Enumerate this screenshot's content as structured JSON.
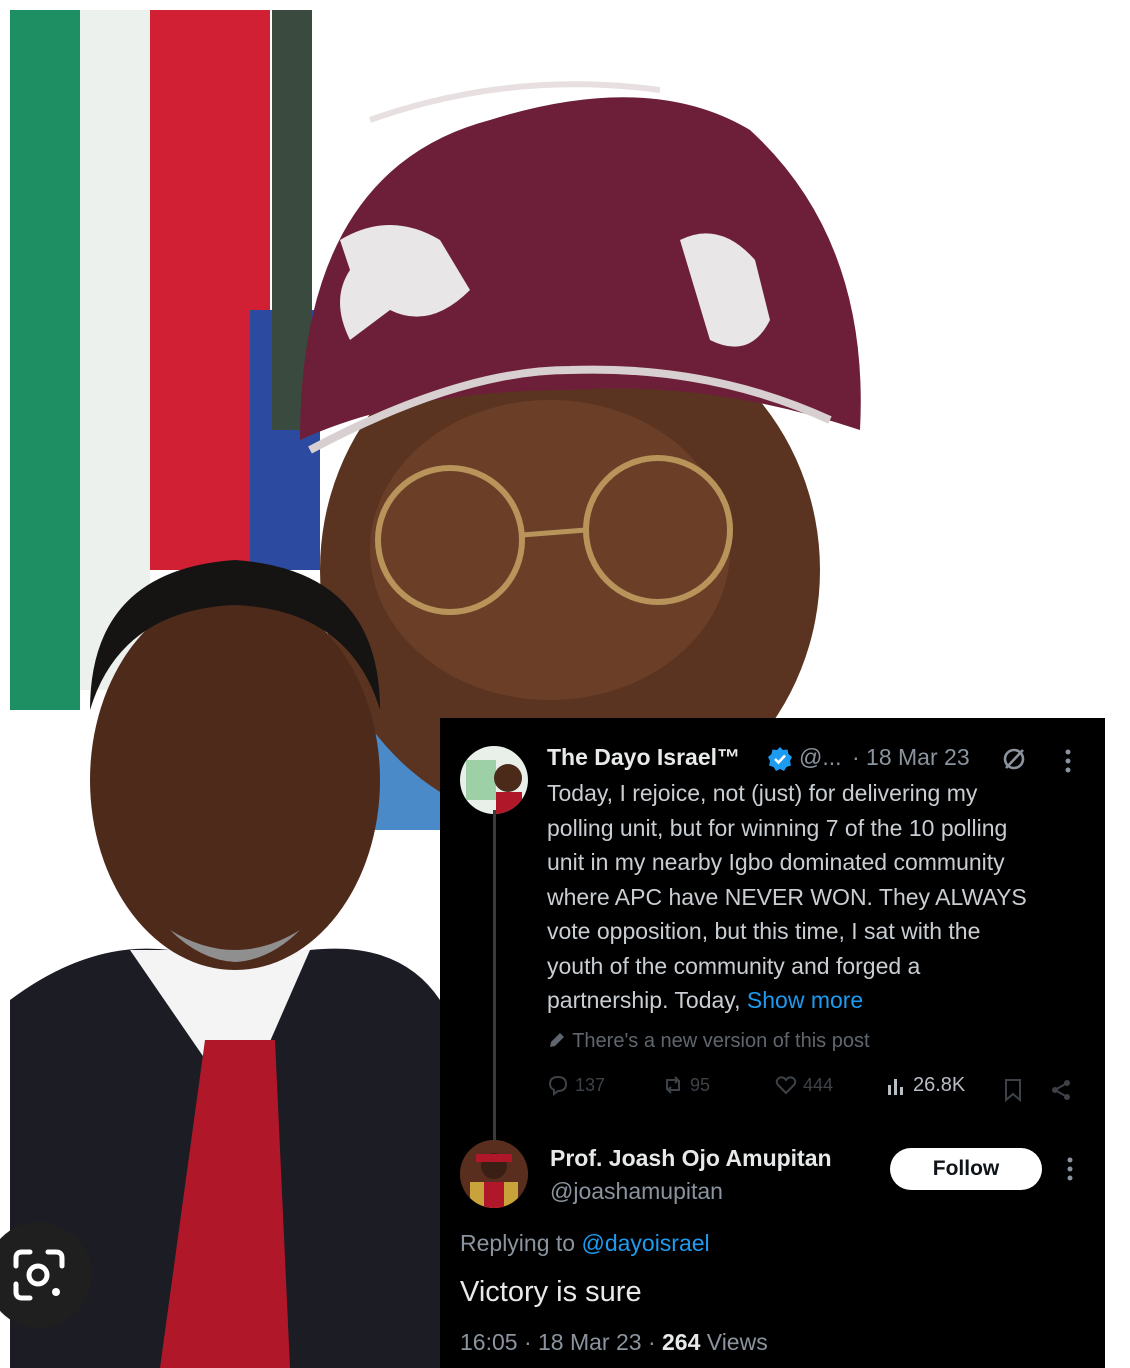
{
  "lens": {
    "icon": "lens-search-icon"
  },
  "post": {
    "author_name": "The Dayo Israel™",
    "author_handle": "@...",
    "date": "· 18 Mar 23",
    "body_lines": [
      "Today, I rejoice, not (just) for delivering my",
      "polling unit, but for winning 7 of the 10 polling",
      "unit in my nearby Igbo dominated community",
      "where APC have NEVER WON. They ALWAYS",
      "vote opposition, but this time, I sat with the",
      "youth of the community and forged a",
      "partnership. Today, "
    ],
    "show_more": "Show more",
    "edited_notice": "There's a new version of this post",
    "replies": "137",
    "reposts": "95",
    "likes": "444",
    "views": "26.8K"
  },
  "reply": {
    "author_name": "Prof. Joash Ojo Amupitan",
    "author_handle": "@joashamupitan",
    "follow_label": "Follow",
    "replying_prefix": "Replying to ",
    "replying_handle": "@dayoisrael",
    "text": "Victory is sure",
    "time_date": "16:05 · 18 Mar 23 · ",
    "views_count": "264",
    "views_label": " Views"
  },
  "colors": {
    "panel_bg": "#000000",
    "link": "#1d9bf0",
    "verified": "#1d9bf0",
    "follow_bg": "#ffffff",
    "cap": "#6d1f3a",
    "flag_green": "#1e8f63",
    "flag_red": "#d11f33"
  }
}
